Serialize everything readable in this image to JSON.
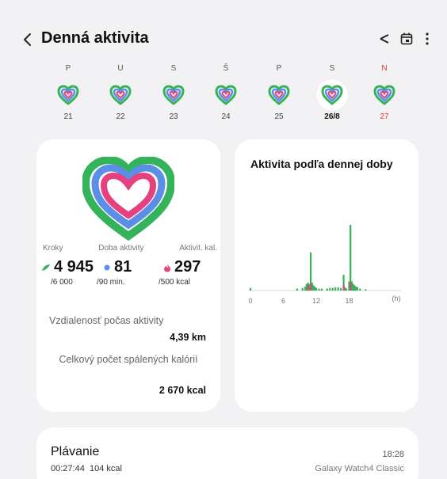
{
  "header": {
    "title": "Denná aktivita"
  },
  "week": {
    "days": [
      {
        "letter": "P",
        "num": "21"
      },
      {
        "letter": "U",
        "num": "22"
      },
      {
        "letter": "S",
        "num": "23"
      },
      {
        "letter": "Š",
        "num": "24"
      },
      {
        "letter": "P",
        "num": "25"
      },
      {
        "letter": "S",
        "num": "26/8"
      },
      {
        "letter": "N",
        "num": "27"
      }
    ],
    "selected_index": 5
  },
  "summary": {
    "steps_label": "Kroky",
    "active_time_label": "Doba aktivity",
    "active_cal_label": "Aktivit. kal.",
    "steps_value": "4 945",
    "steps_goal": "/6 000",
    "active_time_value": "81",
    "active_time_goal": "/90 min.",
    "active_cal_value": "297",
    "active_cal_goal": "/500 kcal",
    "distance_label": "Vzdialenosť počas aktivity",
    "distance_value": "4,39 km",
    "calories_label": "Celkový počet spálených kalórií",
    "calories_value": "2 670 kcal"
  },
  "colors": {
    "steps": "#35b35a",
    "active_time": "#5b8ee6",
    "active_cal": "#e8407f"
  },
  "chart_data": {
    "type": "bar",
    "title": "Aktivita podľa dennej doby",
    "xlabel": "",
    "x_unit": "(h)",
    "x_ticks": [
      "0",
      "6",
      "12",
      "18"
    ],
    "xlim": [
      0,
      24
    ],
    "series": [
      {
        "values": [
          [
            0,
            0.04
          ],
          [
            8.5,
            0.03
          ],
          [
            9.5,
            0.04
          ],
          [
            10.0,
            0.06
          ],
          [
            10.25,
            0.1
          ],
          [
            10.5,
            0.12
          ],
          [
            10.75,
            0.1
          ],
          [
            11.0,
            0.58
          ],
          [
            11.25,
            0.12
          ],
          [
            11.5,
            0.08
          ],
          [
            11.75,
            0.06
          ],
          [
            12.0,
            0.04
          ],
          [
            12.5,
            0.03
          ],
          [
            13.0,
            0.03
          ],
          [
            14.0,
            0.03
          ],
          [
            14.5,
            0.04
          ],
          [
            15.0,
            0.04
          ],
          [
            15.5,
            0.05
          ],
          [
            16.0,
            0.05
          ],
          [
            16.5,
            0.04
          ],
          [
            17.0,
            0.24
          ],
          [
            17.25,
            0.05
          ],
          [
            17.5,
            0.03
          ],
          [
            18.0,
            0.14
          ],
          [
            18.25,
            1.0
          ],
          [
            18.5,
            0.14
          ],
          [
            18.75,
            0.1
          ],
          [
            19.0,
            0.08
          ],
          [
            19.25,
            0.06
          ],
          [
            19.5,
            0.05
          ],
          [
            20.0,
            0.03
          ],
          [
            21.0,
            0.02
          ]
        ],
        "color": "#35b35a"
      },
      {
        "values": [
          [
            10.5,
            0.08
          ],
          [
            11.0,
            0.1
          ],
          [
            17.0,
            0.08
          ],
          [
            18.25,
            0.12
          ]
        ],
        "color": "#e8407f"
      }
    ]
  },
  "workout": {
    "title": "Plávanie",
    "duration": "00:27:44",
    "calories": "104 kcal",
    "time": "18:28",
    "device": "Galaxy Watch4 Classic"
  }
}
